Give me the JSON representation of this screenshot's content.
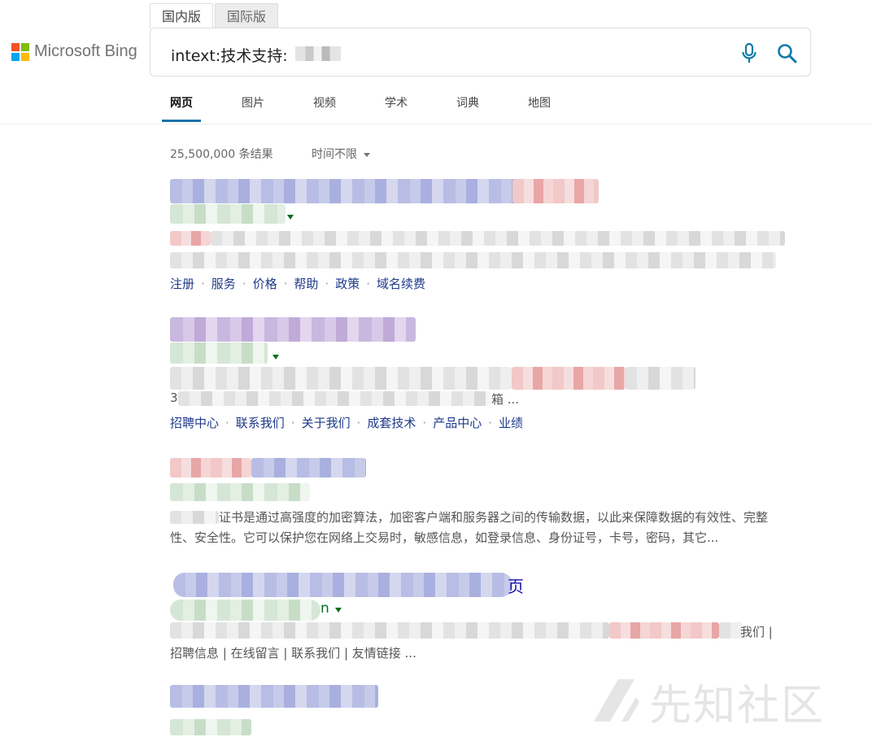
{
  "logo": {
    "text": "Microsoft Bing",
    "colors": [
      "#f35325",
      "#81bc06",
      "#05a6f0",
      "#ffba08"
    ]
  },
  "region_tabs": [
    {
      "label": "国内版",
      "active": true
    },
    {
      "label": "国际版",
      "active": false
    }
  ],
  "search": {
    "query": "intext:技术支持:",
    "mic_icon": "microphone-icon",
    "search_icon": "search-icon",
    "accent": "#117aa8"
  },
  "vertical_tabs": [
    {
      "label": "网页",
      "active": true
    },
    {
      "label": "图片",
      "active": false
    },
    {
      "label": "视频",
      "active": false
    },
    {
      "label": "学术",
      "active": false
    },
    {
      "label": "词典",
      "active": false
    },
    {
      "label": "地图",
      "active": false
    }
  ],
  "results_info": {
    "count": "25,500,000 条结果",
    "time_filter": "时间不限"
  },
  "results": [
    {
      "deep_links": [
        "注册",
        "服务",
        "价格",
        "帮助",
        "政策",
        "域名续费"
      ]
    },
    {
      "snippet_start": "3",
      "snippet_end": "箱 ...",
      "deep_links": [
        "招聘中心",
        "联系我们",
        "关于我们",
        "成套技术",
        "产品中心",
        "业绩"
      ]
    },
    {
      "snippet": "证书是通过高强度的加密算法，加密客户端和服务器之间的传输数据，以此来保障数据的有效性、完整性、安全性。它可以保护您在网络上交易时，敏感信息，如登录信息、身份证号，卡号，密码，其它..."
    },
    {
      "title_tail": "页",
      "url_tail": "n",
      "snippet_line1_end": "我们 |",
      "snippet_line2": "招聘信息 | 在线留言 | 联系我们 | 友情链接 ..."
    },
    {}
  ],
  "watermark": {
    "text": "先知社区",
    "icon": "xianzhi-logo-icon"
  }
}
